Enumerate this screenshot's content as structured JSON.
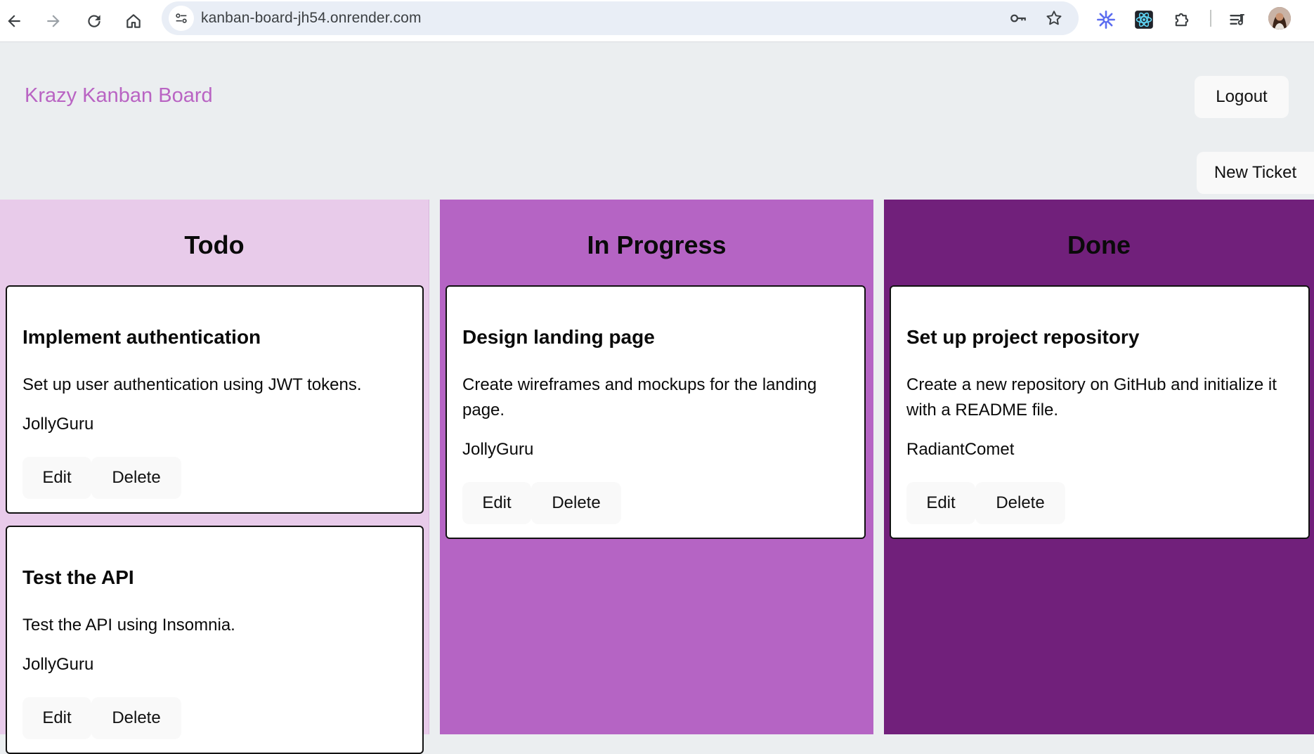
{
  "browser": {
    "url": "kanban-board-jh54.onrender.com",
    "icons": [
      "back-arrow-icon",
      "forward-arrow-icon",
      "reload-icon",
      "home-icon",
      "site-info-icon",
      "password-key-icon",
      "bookmark-star-icon",
      "extension-snowflake-icon",
      "react-devtools-icon",
      "extensions-puzzle-icon",
      "media-queue-icon",
      "profile-avatar"
    ]
  },
  "header": {
    "title": "Krazy Kanban Board",
    "logout_label": "Logout",
    "new_ticket_label": "New Ticket"
  },
  "colors": {
    "title": "#b964c3",
    "todo": "#e8cbea",
    "in_progress": "#b564c4",
    "done": "#71207b"
  },
  "columns": [
    {
      "heading": "Todo",
      "cards": [
        {
          "title": "Implement authentication",
          "description": "Set up user authentication using JWT tokens.",
          "user": "JollyGuru",
          "edit_label": "Edit",
          "delete_label": "Delete"
        },
        {
          "title": "Test the API",
          "description": "Test the API using Insomnia.",
          "user": "JollyGuru",
          "edit_label": "Edit",
          "delete_label": "Delete"
        }
      ]
    },
    {
      "heading": "In Progress",
      "cards": [
        {
          "title": "Design landing page",
          "description": "Create wireframes and mockups for the landing page.",
          "user": "JollyGuru",
          "edit_label": "Edit",
          "delete_label": "Delete"
        }
      ]
    },
    {
      "heading": "Done",
      "cards": [
        {
          "title": "Set up project repository",
          "description": "Create a new repository on GitHub and initialize it with a README file.",
          "user": "RadiantComet",
          "edit_label": "Edit",
          "delete_label": "Delete"
        }
      ]
    }
  ]
}
